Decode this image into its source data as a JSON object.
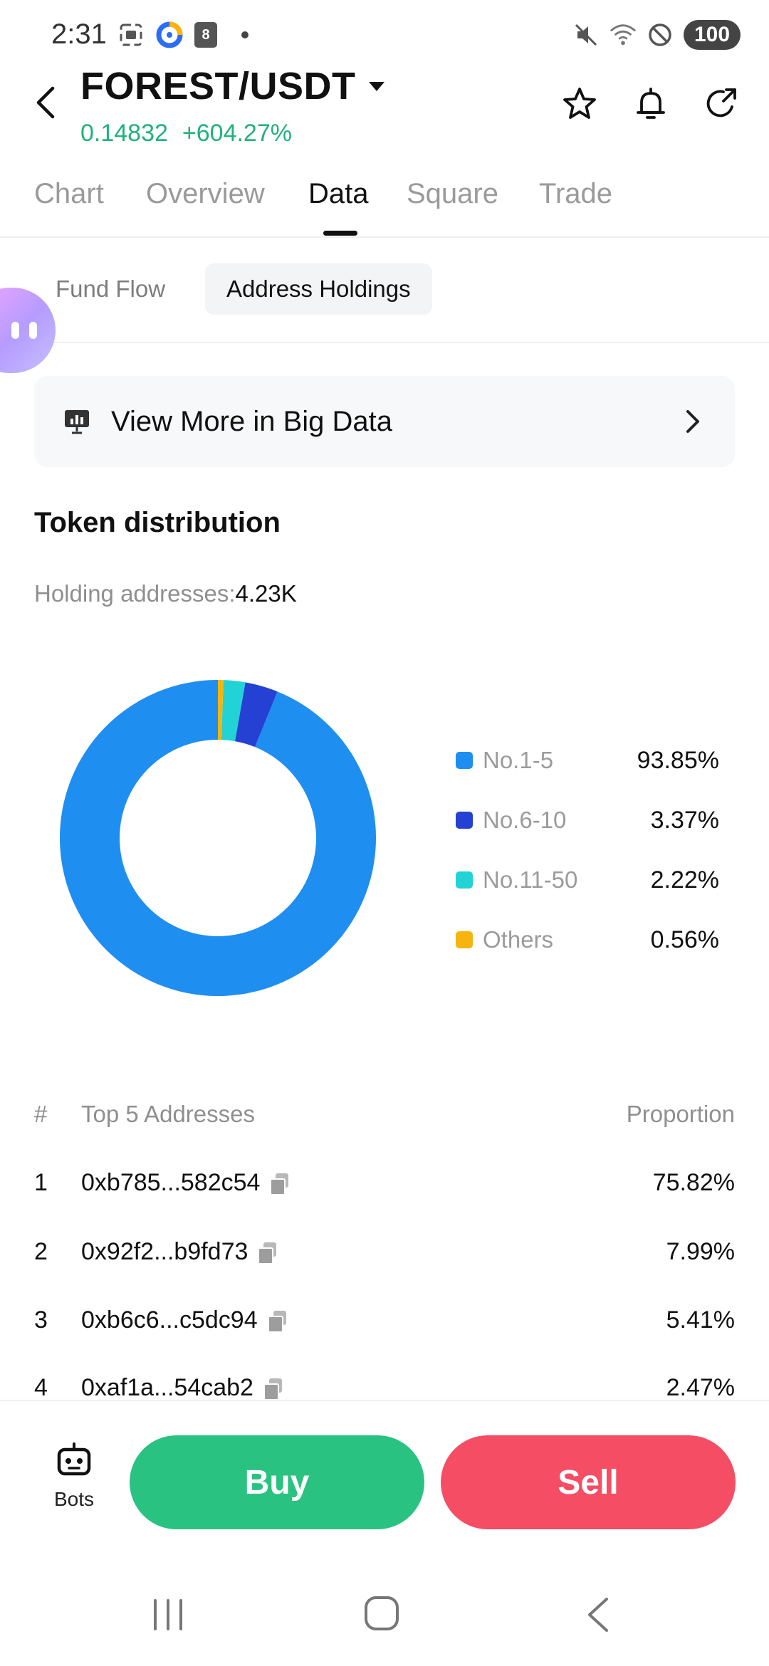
{
  "status_bar": {
    "time": "2:31",
    "calendar_day": "8",
    "battery": "100"
  },
  "header": {
    "pair": "FOREST/USDT",
    "price": "0.14832",
    "change": "+604.27%",
    "price_color": "#21b27c"
  },
  "tabs": [
    {
      "label": "Chart"
    },
    {
      "label": "Overview"
    },
    {
      "label": "Data"
    },
    {
      "label": "Square"
    },
    {
      "label": "Trade"
    }
  ],
  "active_tab": "Data",
  "subtabs": [
    {
      "label": "Fund Flow"
    },
    {
      "label": "Address Holdings"
    }
  ],
  "active_subtab": "Address Holdings",
  "big_data": {
    "label": "View More in Big Data"
  },
  "distribution": {
    "title": "Token distribution",
    "holding_label": "Holding addresses:",
    "holding_value": "4.23K"
  },
  "chart_data": {
    "type": "pie",
    "categories": [
      "No.1-5",
      "No.6-10",
      "No.11-50",
      "Others"
    ],
    "values": [
      93.85,
      3.37,
      2.22,
      0.56
    ],
    "value_labels": [
      "93.85%",
      "3.37%",
      "2.22%",
      "0.56%"
    ],
    "colors": [
      "#1f8ef1",
      "#2441d4",
      "#22d3d6",
      "#f6b40e"
    ],
    "donut": true,
    "legend_position": "right"
  },
  "table": {
    "col_hash": "#",
    "col_address": "Top 5 Addresses",
    "col_proportion": "Proportion",
    "rows": [
      {
        "rank": "1",
        "address": "0xb785...582c54",
        "proportion": "75.82%"
      },
      {
        "rank": "2",
        "address": "0x92f2...b9fd73",
        "proportion": "7.99%"
      },
      {
        "rank": "3",
        "address": "0xb6c6...c5dc94",
        "proportion": "5.41%"
      },
      {
        "rank": "4",
        "address": "0xaf1a...54cab2",
        "proportion": "2.47%"
      }
    ]
  },
  "bottom_bar": {
    "bots_label": "Bots",
    "buy_label": "Buy",
    "sell_label": "Sell",
    "buy_color": "#2ac281",
    "sell_color": "#f54d63"
  }
}
